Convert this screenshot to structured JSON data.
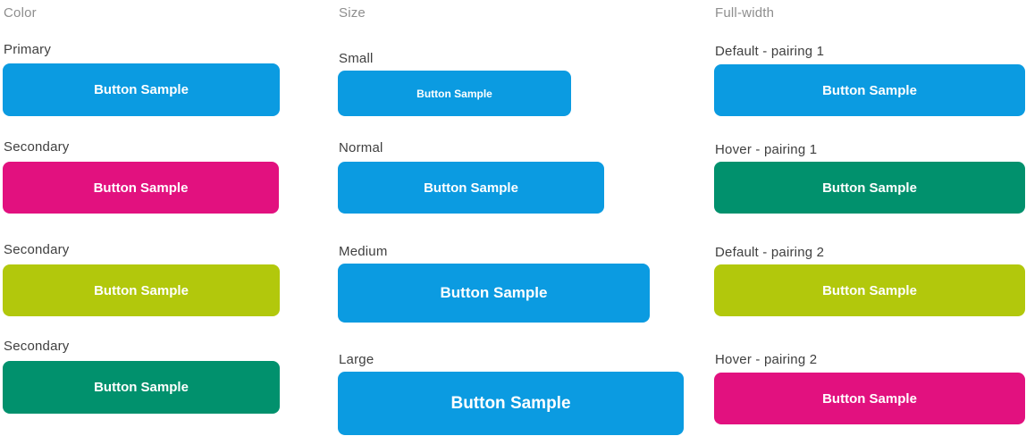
{
  "columns": {
    "color": {
      "heading": "Color",
      "items": [
        {
          "label": "Primary",
          "button": "Button Sample",
          "color": "#0b9be1"
        },
        {
          "label": "Secondary",
          "button": "Button Sample",
          "color": "#e2117f"
        },
        {
          "label": "Secondary",
          "button": "Button Sample",
          "color": "#b2c80c"
        },
        {
          "label": "Secondary",
          "button": "Button Sample",
          "color": "#01916d"
        }
      ]
    },
    "size": {
      "heading": "Size",
      "items": [
        {
          "label": "Small",
          "button": "Button Sample",
          "color": "#0b9be1"
        },
        {
          "label": "Normal",
          "button": "Button Sample",
          "color": "#0b9be1"
        },
        {
          "label": "Medium",
          "button": "Button Sample",
          "color": "#0b9be1"
        },
        {
          "label": "Large",
          "button": "Button Sample",
          "color": "#0b9be1"
        }
      ]
    },
    "full_width": {
      "heading": "Full-width",
      "items": [
        {
          "label": "Default - pairing 1",
          "button": "Button Sample",
          "color": "#0b9be1"
        },
        {
          "label": "Hover - pairing 1",
          "button": "Button Sample",
          "color": "#01916d"
        },
        {
          "label": "Default - pairing 2",
          "button": "Button Sample",
          "color": "#b2c80c"
        },
        {
          "label": "Hover - pairing 2",
          "button": "Button Sample",
          "color": "#e2117f"
        }
      ]
    }
  }
}
